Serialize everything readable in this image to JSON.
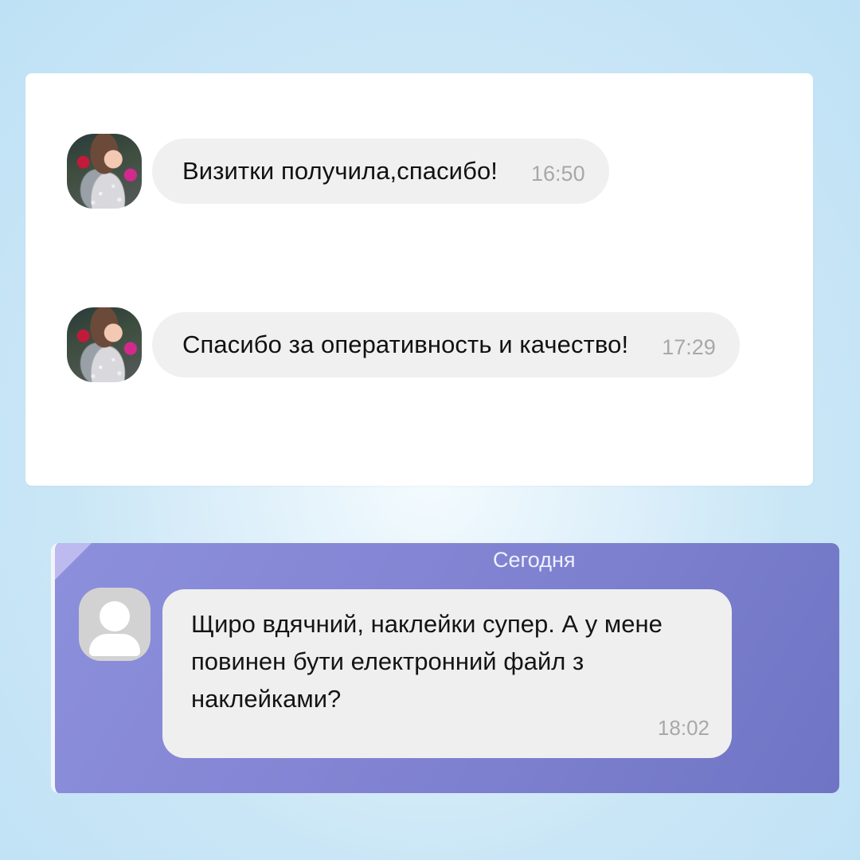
{
  "top_chat": {
    "messages": [
      {
        "text": "Визитки получила,спасибо!",
        "time": "16:50"
      },
      {
        "text": "Спасибо за оперативность и качество!",
        "time": "17:29"
      }
    ]
  },
  "bottom_chat": {
    "date_label": "Сегодня",
    "message": {
      "text": "Щиро вдячний, наклейки супер. А у мене повинен бути електронний файл з наклейками?",
      "time": "18:02"
    }
  },
  "icons": {
    "user_avatar": "user-photo-avatar",
    "placeholder_avatar": "person-silhouette-icon"
  }
}
